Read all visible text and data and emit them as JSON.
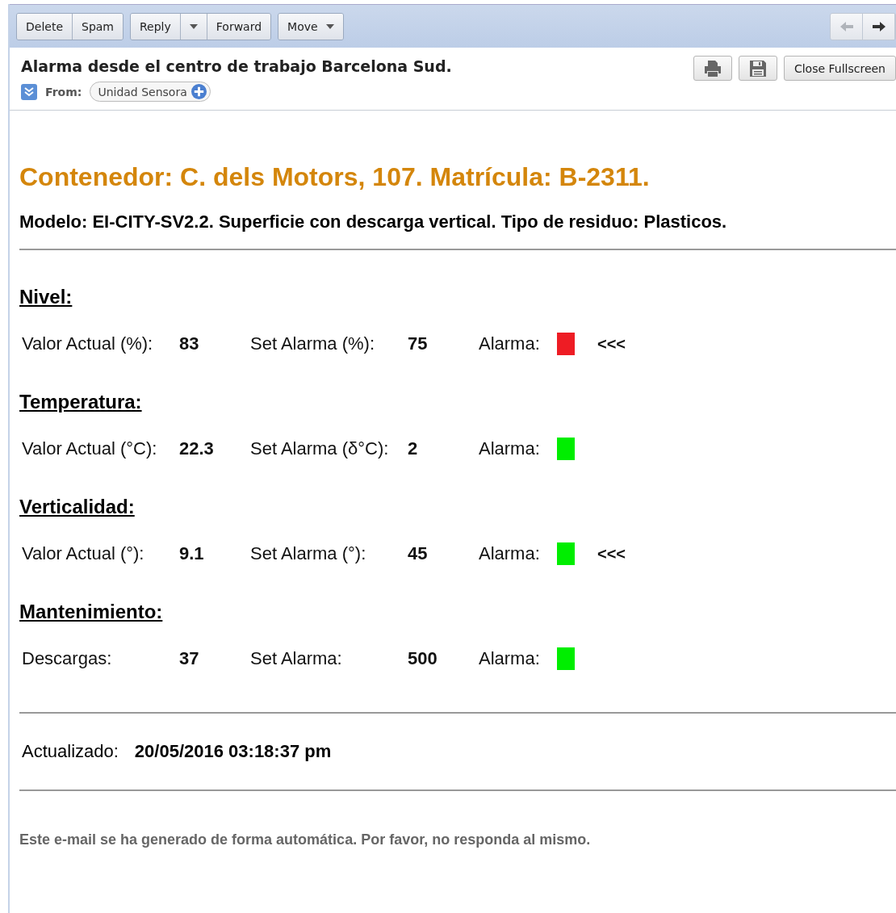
{
  "toolbar": {
    "groups": [
      [
        {
          "label": "Delete",
          "kind": "text"
        },
        {
          "label": "Spam",
          "kind": "text"
        }
      ],
      [
        {
          "label": "Reply",
          "kind": "text"
        },
        {
          "kind": "caret"
        },
        {
          "label": "Forward",
          "kind": "text"
        }
      ],
      [
        {
          "label": "Move",
          "kind": "menu"
        }
      ]
    ],
    "nav": [
      {
        "kind": "back",
        "disabled": true
      },
      {
        "kind": "forward",
        "disabled": false
      }
    ]
  },
  "message": {
    "subject": "Alarma desde el centro de trabajo Barcelona Sud.",
    "from_label": "From:",
    "sender": "Unidad Sensora",
    "actions": [
      {
        "kind": "print"
      },
      {
        "kind": "save"
      },
      {
        "kind": "text",
        "label": "Close Fullscreen"
      }
    ]
  },
  "body": {
    "title": "Contenedor: C. dels Motors, 107. Matrícula: B-2311.",
    "subtitle": "Modelo: EI-CITY-SV2.2. Superficie con descarga vertical. Tipo de residuo: Plasticos.",
    "sections": [
      {
        "heading": "Nivel:",
        "value_label": "Valor Actual (%):",
        "value": "83",
        "set_label": "Set Alarma (%):",
        "set_value": "75",
        "alarm_label": "Alarma:",
        "color": "#ee1c24",
        "marker": "<<<"
      },
      {
        "heading": "Temperatura:",
        "value_label": "Valor Actual (°C):",
        "value": "22.3",
        "set_label": "Set Alarma (δ°C):",
        "set_value": "2",
        "alarm_label": "Alarma:",
        "color": "#00ee00"
      },
      {
        "heading": "Verticalidad:",
        "value_label": "Valor Actual (°):",
        "value": "9.1",
        "set_label": "Set Alarma (°):",
        "set_value": "45",
        "alarm_label": "Alarma:",
        "color": "#00ee00",
        "marker": "<<<"
      },
      {
        "heading": "Mantenimiento:",
        "value_label": "Descargas:",
        "value": "37",
        "set_label": "Set Alarma:",
        "set_value": "500",
        "alarm_label": "Alarma:",
        "color": "#00ee00"
      }
    ],
    "updated_label": "Actualizado:",
    "updated": "20/05/2016 03:18:37 pm",
    "footer": "Este e-mail se ha generado de forma automática. Por favor, no responda al mismo."
  }
}
